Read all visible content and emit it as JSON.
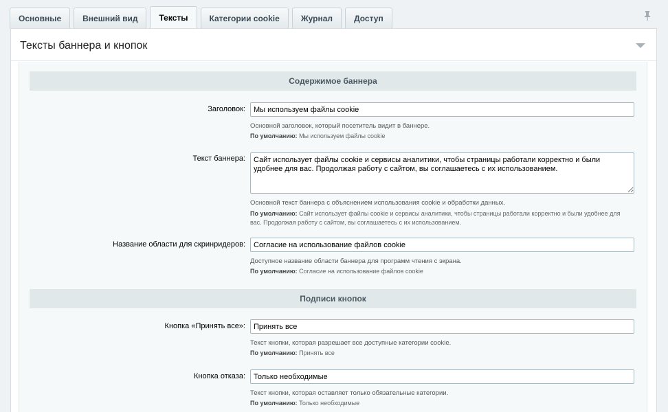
{
  "tabs": [
    {
      "label": "Основные",
      "active": false
    },
    {
      "label": "Внешний вид",
      "active": false
    },
    {
      "label": "Тексты",
      "active": true
    },
    {
      "label": "Категории cookie",
      "active": false
    },
    {
      "label": "Журнал",
      "active": false
    },
    {
      "label": "Доступ",
      "active": false
    }
  ],
  "panel": {
    "title": "Тексты баннера и кнопок"
  },
  "sections": {
    "banner_content": "Содержимое баннера",
    "button_labels": "Подписи кнопок"
  },
  "default_prefix": "По умолчанию:",
  "fields": {
    "heading": {
      "label": "Заголовок:",
      "value": "Мы используем файлы cookie",
      "hint": "Основной заголовок, который посетитель видит в баннере.",
      "default": "Мы используем файлы cookie"
    },
    "banner_text": {
      "label": "Текст баннера:",
      "value": "Сайт использует файлы cookie и сервисы аналитики, чтобы страницы работали корректно и были удобнее для вас. Продолжая работу с сайтом, вы соглашаетесь с их использованием.",
      "hint": "Основной текст баннера с объяснением использования cookie и обработки данных.",
      "default": "Сайт использует файлы cookie и сервисы аналитики, чтобы страницы работали корректно и были удобнее для вас. Продолжая работу с сайтом, вы соглашаетесь с их использованием."
    },
    "aria_label": {
      "label": "Название области для скринридеров:",
      "value": "Согласие на использование файлов cookie",
      "hint": "Доступное название области баннера для программ чтения с экрана.",
      "default": "Согласие на использование файлов cookie"
    },
    "accept_all": {
      "label": "Кнопка «Принять все»:",
      "value": "Принять все",
      "hint": "Текст кнопки, которая разрешает все доступные категории cookie.",
      "default": "Принять все"
    },
    "reject": {
      "label": "Кнопка отказа:",
      "value": "Только необходимые",
      "hint": "Текст кнопки, которая оставляет только обязательные категории.",
      "default": "Только необходимые"
    }
  },
  "icons": {
    "pin": "pin-icon",
    "collapse": "triangle-down-icon"
  },
  "colors": {
    "background": "#eef2f4",
    "section_head": "#e0e8ea",
    "content_bg": "#f5f9f9"
  }
}
